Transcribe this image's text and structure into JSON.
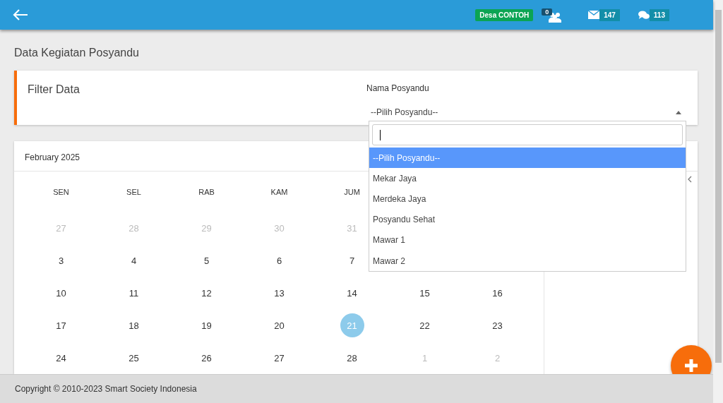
{
  "header": {
    "village_badge": "Desa CONTOH",
    "people_count": "0",
    "mail_count": "147",
    "chat_count": "113"
  },
  "page_title": "Data Kegiatan Posyandu",
  "filter": {
    "title": "Filter Data",
    "field_label": "Nama Posyandu",
    "select_value": "--Pilih Posyandu--",
    "expanded": true,
    "options": [
      {
        "label": "--Pilih Posyandu--",
        "selected": true
      },
      {
        "label": "Mekar Jaya",
        "selected": false
      },
      {
        "label": "Merdeka Jaya",
        "selected": false
      },
      {
        "label": "Posyandu Sehat",
        "selected": false
      },
      {
        "label": "Mawar 1",
        "selected": false
      },
      {
        "label": "Mawar 2",
        "selected": false
      }
    ]
  },
  "calendar": {
    "month": "February 2025",
    "weekdays": [
      "SEN",
      "SEL",
      "RAB",
      "KAM",
      "JUM"
    ],
    "weeks": [
      [
        {
          "label": "27",
          "muted": true,
          "selected": false
        },
        {
          "label": "28",
          "muted": true,
          "selected": false
        },
        {
          "label": "29",
          "muted": true,
          "selected": false
        },
        {
          "label": "30",
          "muted": true,
          "selected": false
        },
        {
          "label": "31",
          "muted": true,
          "selected": false
        }
      ],
      [
        {
          "label": "3",
          "muted": false,
          "selected": false
        },
        {
          "label": "4",
          "muted": false,
          "selected": false
        },
        {
          "label": "5",
          "muted": false,
          "selected": false
        },
        {
          "label": "6",
          "muted": false,
          "selected": false
        },
        {
          "label": "7",
          "muted": false,
          "selected": false
        }
      ],
      [
        {
          "label": "10",
          "muted": false,
          "selected": false
        },
        {
          "label": "11",
          "muted": false,
          "selected": false
        },
        {
          "label": "12",
          "muted": false,
          "selected": false
        },
        {
          "label": "13",
          "muted": false,
          "selected": false
        },
        {
          "label": "14",
          "muted": false,
          "selected": false
        },
        {
          "label": "15",
          "muted": false,
          "selected": false
        },
        {
          "label": "16",
          "muted": false,
          "selected": false
        }
      ],
      [
        {
          "label": "17",
          "muted": false,
          "selected": false
        },
        {
          "label": "18",
          "muted": false,
          "selected": false
        },
        {
          "label": "19",
          "muted": false,
          "selected": false
        },
        {
          "label": "20",
          "muted": false,
          "selected": false
        },
        {
          "label": "21",
          "muted": false,
          "selected": true
        },
        {
          "label": "22",
          "muted": false,
          "selected": false
        },
        {
          "label": "23",
          "muted": false,
          "selected": false
        }
      ],
      [
        {
          "label": "24",
          "muted": false,
          "selected": false
        },
        {
          "label": "25",
          "muted": false,
          "selected": false
        },
        {
          "label": "26",
          "muted": false,
          "selected": false
        },
        {
          "label": "27",
          "muted": false,
          "selected": false
        },
        {
          "label": "28",
          "muted": false,
          "selected": false
        },
        {
          "label": "1",
          "muted": true,
          "selected": false
        },
        {
          "label": "2",
          "muted": true,
          "selected": false
        }
      ]
    ]
  },
  "footer": "Copyright © 2010-2023 Smart Society Indonesia"
}
